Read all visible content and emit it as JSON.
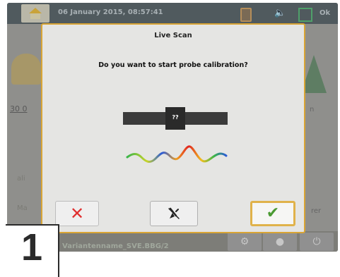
{
  "topbar": {
    "datetime": "06 January 2015, 08:57:41",
    "ok_label": "Ok"
  },
  "background": {
    "left_value": "30 0",
    "left_label_a": "ali",
    "left_label_b": "Ma",
    "right_label_a": "n",
    "right_label_b": "rer",
    "filename": "Variantenname_SVE.BBG/2"
  },
  "modal": {
    "title": "Live Scan",
    "question": "Do you want to start probe calibration?",
    "probe_value": "??",
    "buttons": {
      "cancel_icon": "close-icon",
      "probe_icon": "probe-off-icon",
      "confirm_icon": "check-icon"
    }
  },
  "step": {
    "number": "1"
  },
  "colors": {
    "accent": "#d9a535",
    "cancel": "#e03030",
    "confirm": "#4a9a32"
  }
}
